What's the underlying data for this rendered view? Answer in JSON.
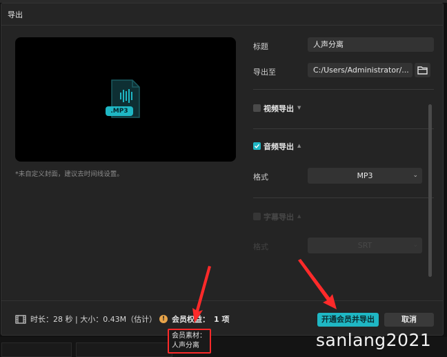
{
  "dialog": {
    "title": "导出"
  },
  "preview": {
    "file_badge": ".MP3",
    "cover_hint": "*未自定义封面，建议去时间线设置。"
  },
  "form": {
    "title_label": "标题",
    "title_value": "人声分离",
    "export_to_label": "导出至",
    "export_path": "C:/Users/Administrator/..."
  },
  "sections": {
    "video": {
      "label": "视频导出",
      "checked": false
    },
    "audio": {
      "label": "音频导出",
      "checked": true,
      "format_label": "格式",
      "format_value": "MP3"
    },
    "subtitle": {
      "label": "字幕导出",
      "checked": false,
      "format_label": "格式",
      "format_value": "SRT"
    }
  },
  "footer": {
    "info": "时长：28 秒 | 大小：0.43M（估计）",
    "member_label": "会员权益：",
    "member_count": "1 项",
    "primary_button": "开通会员并导出",
    "cancel_button": "取消"
  },
  "annotation": {
    "line1": "会员素材：",
    "line2": "人声分离"
  },
  "watermark": "sanlang2021",
  "colors": {
    "accent": "#1fb7c4",
    "annotation_red": "#ff2a2a",
    "warning": "#e8a44a"
  }
}
